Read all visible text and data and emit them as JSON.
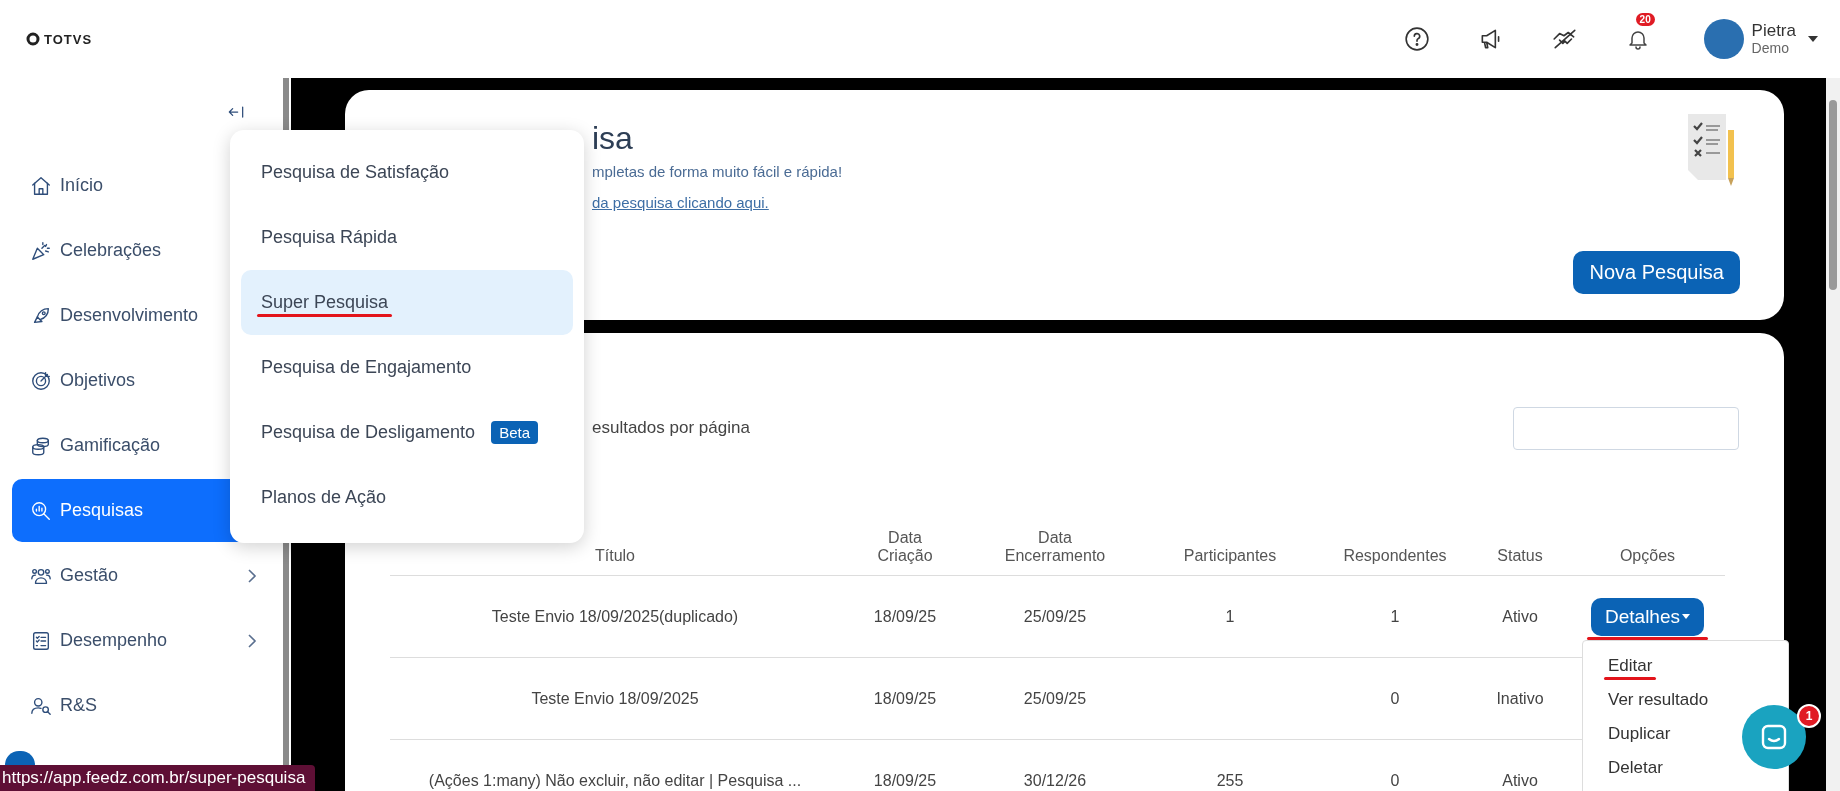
{
  "topbar": {
    "logo": "TOTVS",
    "notifications_badge": "20",
    "user": {
      "name": "Pietra",
      "role": "Demo"
    }
  },
  "sidebar": {
    "items": [
      {
        "label": "Início",
        "has_submenu": false,
        "selected": false
      },
      {
        "label": "Celebrações",
        "has_submenu": false,
        "selected": false
      },
      {
        "label": "Desenvolvimento",
        "has_submenu": false,
        "selected": false
      },
      {
        "label": "Objetivos",
        "has_submenu": false,
        "selected": false
      },
      {
        "label": "Gamificação",
        "has_submenu": false,
        "selected": false
      },
      {
        "label": "Pesquisas",
        "has_submenu": false,
        "selected": true
      },
      {
        "label": "Gestão",
        "has_submenu": true,
        "selected": false
      },
      {
        "label": "Desempenho",
        "has_submenu": true,
        "selected": false
      },
      {
        "label": "R&S",
        "has_submenu": false,
        "selected": false
      }
    ]
  },
  "survey_menu": {
    "items": [
      {
        "label": "Pesquisa de Satisfação",
        "selected": false,
        "underlined": false
      },
      {
        "label": "Pesquisa Rápida",
        "selected": false,
        "underlined": false
      },
      {
        "label": "Super Pesquisa",
        "selected": true,
        "underlined": true
      },
      {
        "label": "Pesquisa de Engajamento",
        "selected": false,
        "underlined": false
      },
      {
        "label": "Pesquisa de Desligamento",
        "selected": false,
        "underlined": false,
        "badge": "Beta"
      },
      {
        "label": "Planos de Ação",
        "selected": false,
        "underlined": false
      }
    ]
  },
  "header_card": {
    "title": "isa",
    "subtitle": "mpletas de forma muito fácil e rápida!",
    "link": "da pesquisa clicando aqui.",
    "button": "Nova Pesquisa"
  },
  "table_card": {
    "page_size_label": "esultados por página",
    "columns": [
      "Título",
      "Data Criação",
      "Data Encerramento",
      "Participantes",
      "Respondentes",
      "Status",
      "Opções"
    ],
    "rows": [
      {
        "title": "Teste Envio 18/09/2025(duplicado)",
        "created": "18/09/25",
        "closed": "25/09/25",
        "participants": "1",
        "respondents": "1",
        "status": "Ativo",
        "options_button": {
          "label": "Detalhes",
          "underlined": true
        }
      },
      {
        "title": "Teste Envio 18/09/2025",
        "created": "18/09/25",
        "closed": "25/09/25",
        "respondents": "0",
        "status": "Inativo"
      },
      {
        "title": "(Ações 1:many) Não excluir, não editar | Pesquisa ...",
        "created": "18/09/25",
        "closed": "30/12/26",
        "participants": "255",
        "respondents": "0",
        "status": "Ativo"
      }
    ]
  },
  "options_menu": {
    "items": [
      {
        "label": "Editar",
        "underlined": true
      },
      {
        "label": "Ver resultado",
        "underlined": false
      },
      {
        "label": "Duplicar",
        "underlined": false
      },
      {
        "label": "Deletar",
        "underlined": false
      }
    ]
  },
  "chat": {
    "badge": "1"
  },
  "status_url": "https://app.feedz.com.br/super-pesquisa"
}
